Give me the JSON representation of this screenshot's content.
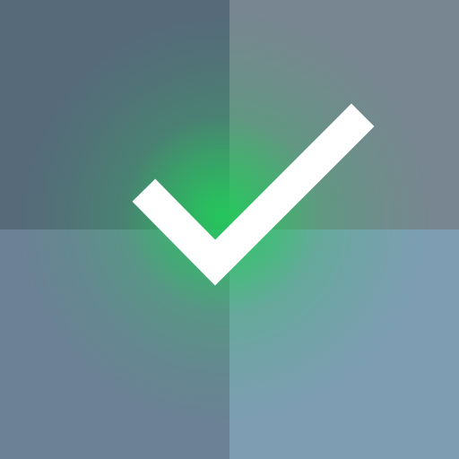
{
  "icon": {
    "name": "checkmark-icon",
    "stroke_color": "#ffffff",
    "glow_color": "#22cc5a"
  },
  "background": {
    "top_left": "#566a7a",
    "top_right": "#778690",
    "bottom_left": "#6c8196",
    "bottom_right": "#7e9db3"
  }
}
